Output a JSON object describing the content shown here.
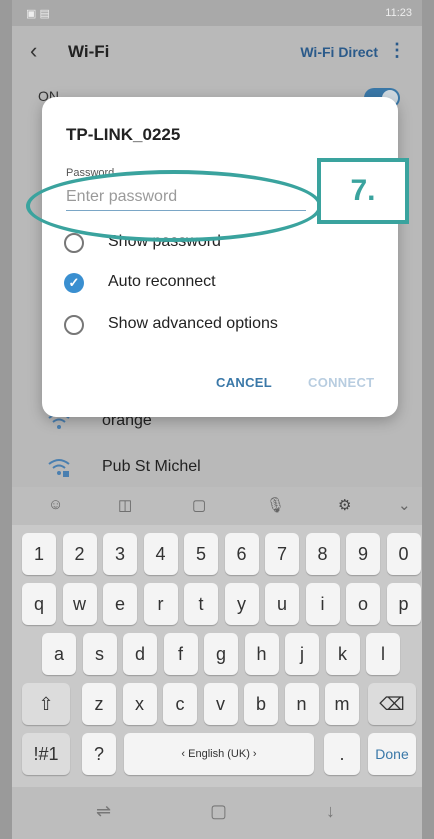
{
  "status": {
    "right": "11:23"
  },
  "appbar": {
    "title": "Wi-Fi",
    "wifi_direct": "Wi-Fi Direct"
  },
  "onrow": "ON",
  "networks": [
    {
      "name": "orange"
    },
    {
      "name": "Pub St Michel"
    }
  ],
  "dialog": {
    "title": "TP-LINK_0225",
    "password_label": "Password",
    "password_placeholder": "Enter password",
    "show_password": "Show password",
    "auto_reconnect": "Auto reconnect",
    "show_advanced": "Show advanced options",
    "cancel": "CANCEL",
    "connect": "CONNECT"
  },
  "annotation": {
    "step": "7."
  },
  "keyboard": {
    "row_numbers": [
      "1",
      "2",
      "3",
      "4",
      "5",
      "6",
      "7",
      "8",
      "9",
      "0"
    ],
    "row1": [
      "q",
      "w",
      "e",
      "r",
      "t",
      "y",
      "u",
      "i",
      "o",
      "p"
    ],
    "row2": [
      "a",
      "s",
      "d",
      "f",
      "g",
      "h",
      "j",
      "k",
      "l"
    ],
    "row3": [
      "z",
      "x",
      "c",
      "v",
      "b",
      "n",
      "m"
    ],
    "sym": "!#1",
    "question": "?",
    "space": "‹ English (UK) ›",
    "period": ".",
    "done": "Done"
  },
  "colors": {
    "accent": "#3a78a8",
    "annotation": "#3aa39e"
  }
}
